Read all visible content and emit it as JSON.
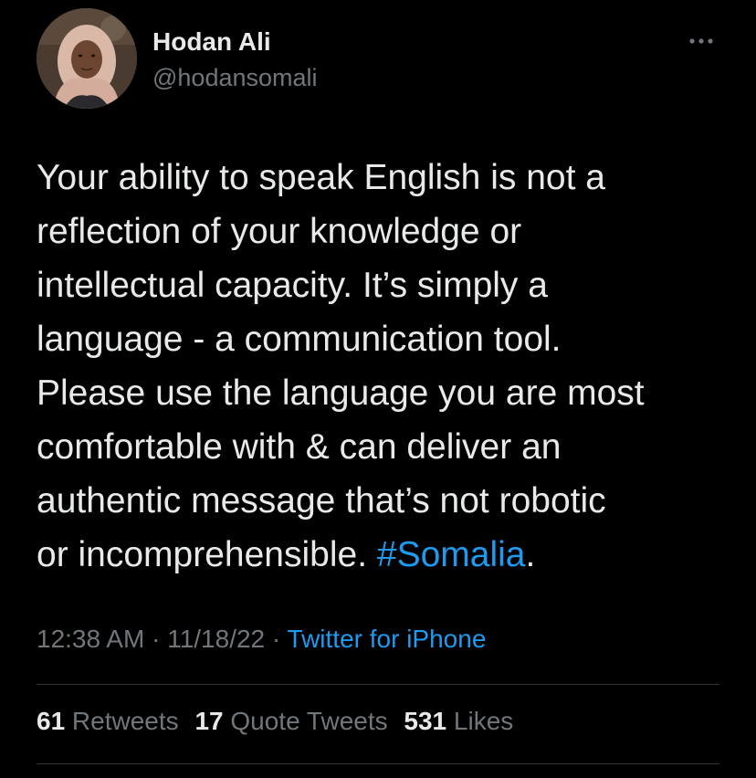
{
  "author": {
    "name": "Hodan Ali",
    "handle": "@hodansomali"
  },
  "tweet": {
    "lines": [
      "Your ability to speak English is not a",
      "reflection of your knowledge or",
      "intellectual capacity. It’s simply a",
      "language - a communication tool.",
      "Please use the language you are most",
      "comfortable with & can deliver an",
      "authentic message that’s not robotic",
      "or incomprehensible. "
    ],
    "hashtag": "#Somalia",
    "trailing": "."
  },
  "meta": {
    "time": "12:38 AM",
    "sep1": " · ",
    "date": "11/18/22",
    "sep2": " · ",
    "source": "Twitter for iPhone"
  },
  "stats": {
    "retweets_count": "61",
    "retweets_label": " Retweets",
    "quotes_count": "17",
    "quotes_label": " Quote Tweets",
    "likes_count": "531",
    "likes_label": " Likes"
  },
  "icons": {
    "more": "more-horizontal-icon"
  },
  "colors": {
    "background": "#000000",
    "text": "#e7e9ea",
    "secondary": "#71767b",
    "accent": "#1d9bf0",
    "divider": "#2f3336"
  }
}
